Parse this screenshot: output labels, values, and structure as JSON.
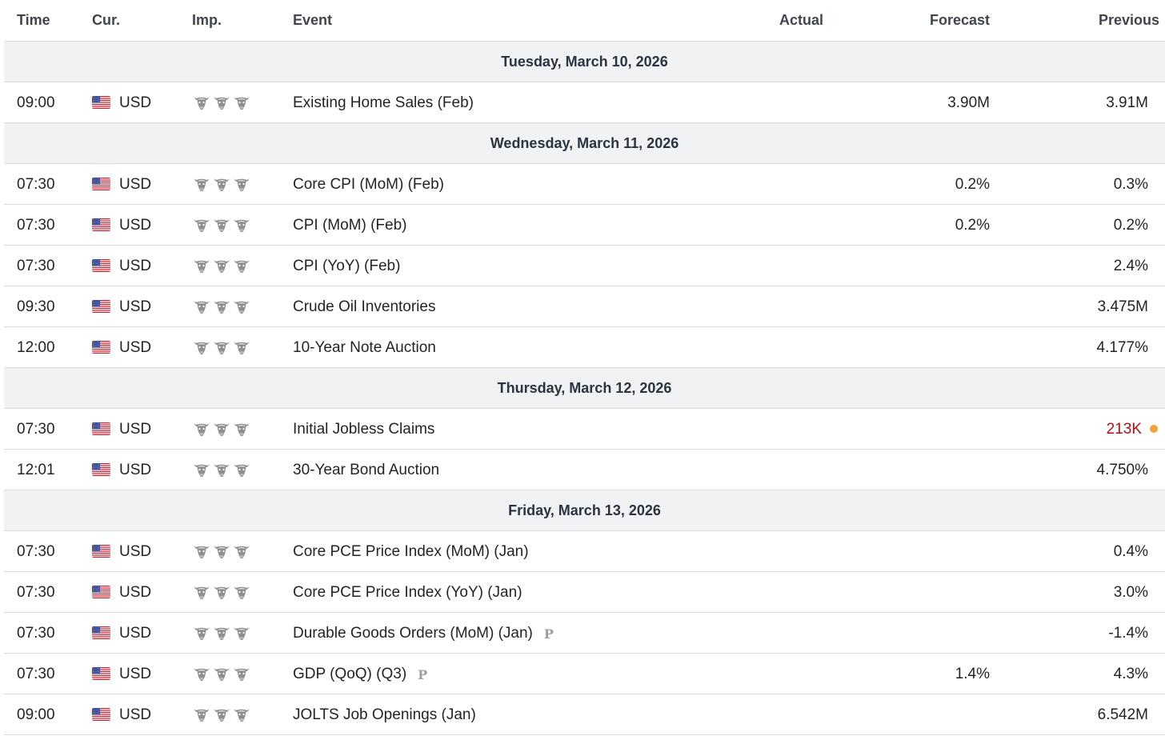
{
  "columns": {
    "time": "Time",
    "currency": "Cur.",
    "importance": "Imp.",
    "event": "Event",
    "actual": "Actual",
    "forecast": "Forecast",
    "previous": "Previous"
  },
  "colors": {
    "date_row_bg": "#f1f2f3",
    "negative_red": "#b01212",
    "revised_dot": "#f2a33a",
    "bull_grey": "#8d8f92"
  },
  "groups": [
    {
      "date": "Tuesday, March 10, 2026",
      "events": [
        {
          "time": "09:00",
          "currency": "USD",
          "flag_icon": "us-flag-icon",
          "importance": 3,
          "event": "Existing Home Sales (Feb)",
          "preliminary": false,
          "actual": "",
          "forecast": "3.90M",
          "previous": "3.91M",
          "previous_revised": false
        }
      ]
    },
    {
      "date": "Wednesday, March 11, 2026",
      "events": [
        {
          "time": "07:30",
          "currency": "USD",
          "flag_icon": "us-flag-icon",
          "importance": 3,
          "event": "Core CPI (MoM) (Feb)",
          "preliminary": false,
          "actual": "",
          "forecast": "0.2%",
          "previous": "0.3%",
          "previous_revised": false
        },
        {
          "time": "07:30",
          "currency": "USD",
          "flag_icon": "us-flag-icon",
          "importance": 3,
          "event": "CPI (MoM) (Feb)",
          "preliminary": false,
          "actual": "",
          "forecast": "0.2%",
          "previous": "0.2%",
          "previous_revised": false
        },
        {
          "time": "07:30",
          "currency": "USD",
          "flag_icon": "us-flag-icon",
          "importance": 3,
          "event": "CPI (YoY) (Feb)",
          "preliminary": false,
          "actual": "",
          "forecast": "",
          "previous": "2.4%",
          "previous_revised": false
        },
        {
          "time": "09:30",
          "currency": "USD",
          "flag_icon": "us-flag-icon",
          "importance": 3,
          "event": "Crude Oil Inventories",
          "preliminary": false,
          "actual": "",
          "forecast": "",
          "previous": "3.475M",
          "previous_revised": false
        },
        {
          "time": "12:00",
          "currency": "USD",
          "flag_icon": "us-flag-icon",
          "importance": 3,
          "event": "10-Year Note Auction",
          "preliminary": false,
          "actual": "",
          "forecast": "",
          "previous": "4.177%",
          "previous_revised": false
        }
      ]
    },
    {
      "date": "Thursday, March 12, 2026",
      "events": [
        {
          "time": "07:30",
          "currency": "USD",
          "flag_icon": "us-flag-icon",
          "importance": 3,
          "event": "Initial Jobless Claims",
          "preliminary": false,
          "actual": "",
          "forecast": "",
          "previous": "213K",
          "previous_revised": true
        },
        {
          "time": "12:01",
          "currency": "USD",
          "flag_icon": "us-flag-icon",
          "importance": 3,
          "event": "30-Year Bond Auction",
          "preliminary": false,
          "actual": "",
          "forecast": "",
          "previous": "4.750%",
          "previous_revised": false
        }
      ]
    },
    {
      "date": "Friday, March 13, 2026",
      "events": [
        {
          "time": "07:30",
          "currency": "USD",
          "flag_icon": "us-flag-icon",
          "importance": 3,
          "event": "Core PCE Price Index (MoM) (Jan)",
          "preliminary": false,
          "actual": "",
          "forecast": "",
          "previous": "0.4%",
          "previous_revised": false
        },
        {
          "time": "07:30",
          "currency": "USD",
          "flag_icon": "us-flag-icon",
          "importance": 3,
          "event": "Core PCE Price Index (YoY) (Jan)",
          "preliminary": false,
          "actual": "",
          "forecast": "",
          "previous": "3.0%",
          "previous_revised": false
        },
        {
          "time": "07:30",
          "currency": "USD",
          "flag_icon": "us-flag-icon",
          "importance": 3,
          "event": "Durable Goods Orders (MoM) (Jan)",
          "preliminary": true,
          "actual": "",
          "forecast": "",
          "previous": "-1.4%",
          "previous_revised": false
        },
        {
          "time": "07:30",
          "currency": "USD",
          "flag_icon": "us-flag-icon",
          "importance": 3,
          "event": "GDP (QoQ) (Q3)",
          "preliminary": true,
          "actual": "",
          "forecast": "1.4%",
          "previous": "4.3%",
          "previous_revised": false
        },
        {
          "time": "09:00",
          "currency": "USD",
          "flag_icon": "us-flag-icon",
          "importance": 3,
          "event": "JOLTS Job Openings (Jan)",
          "preliminary": false,
          "actual": "",
          "forecast": "",
          "previous": "6.542M",
          "previous_revised": false
        }
      ]
    }
  ],
  "preliminary_mark": "P"
}
